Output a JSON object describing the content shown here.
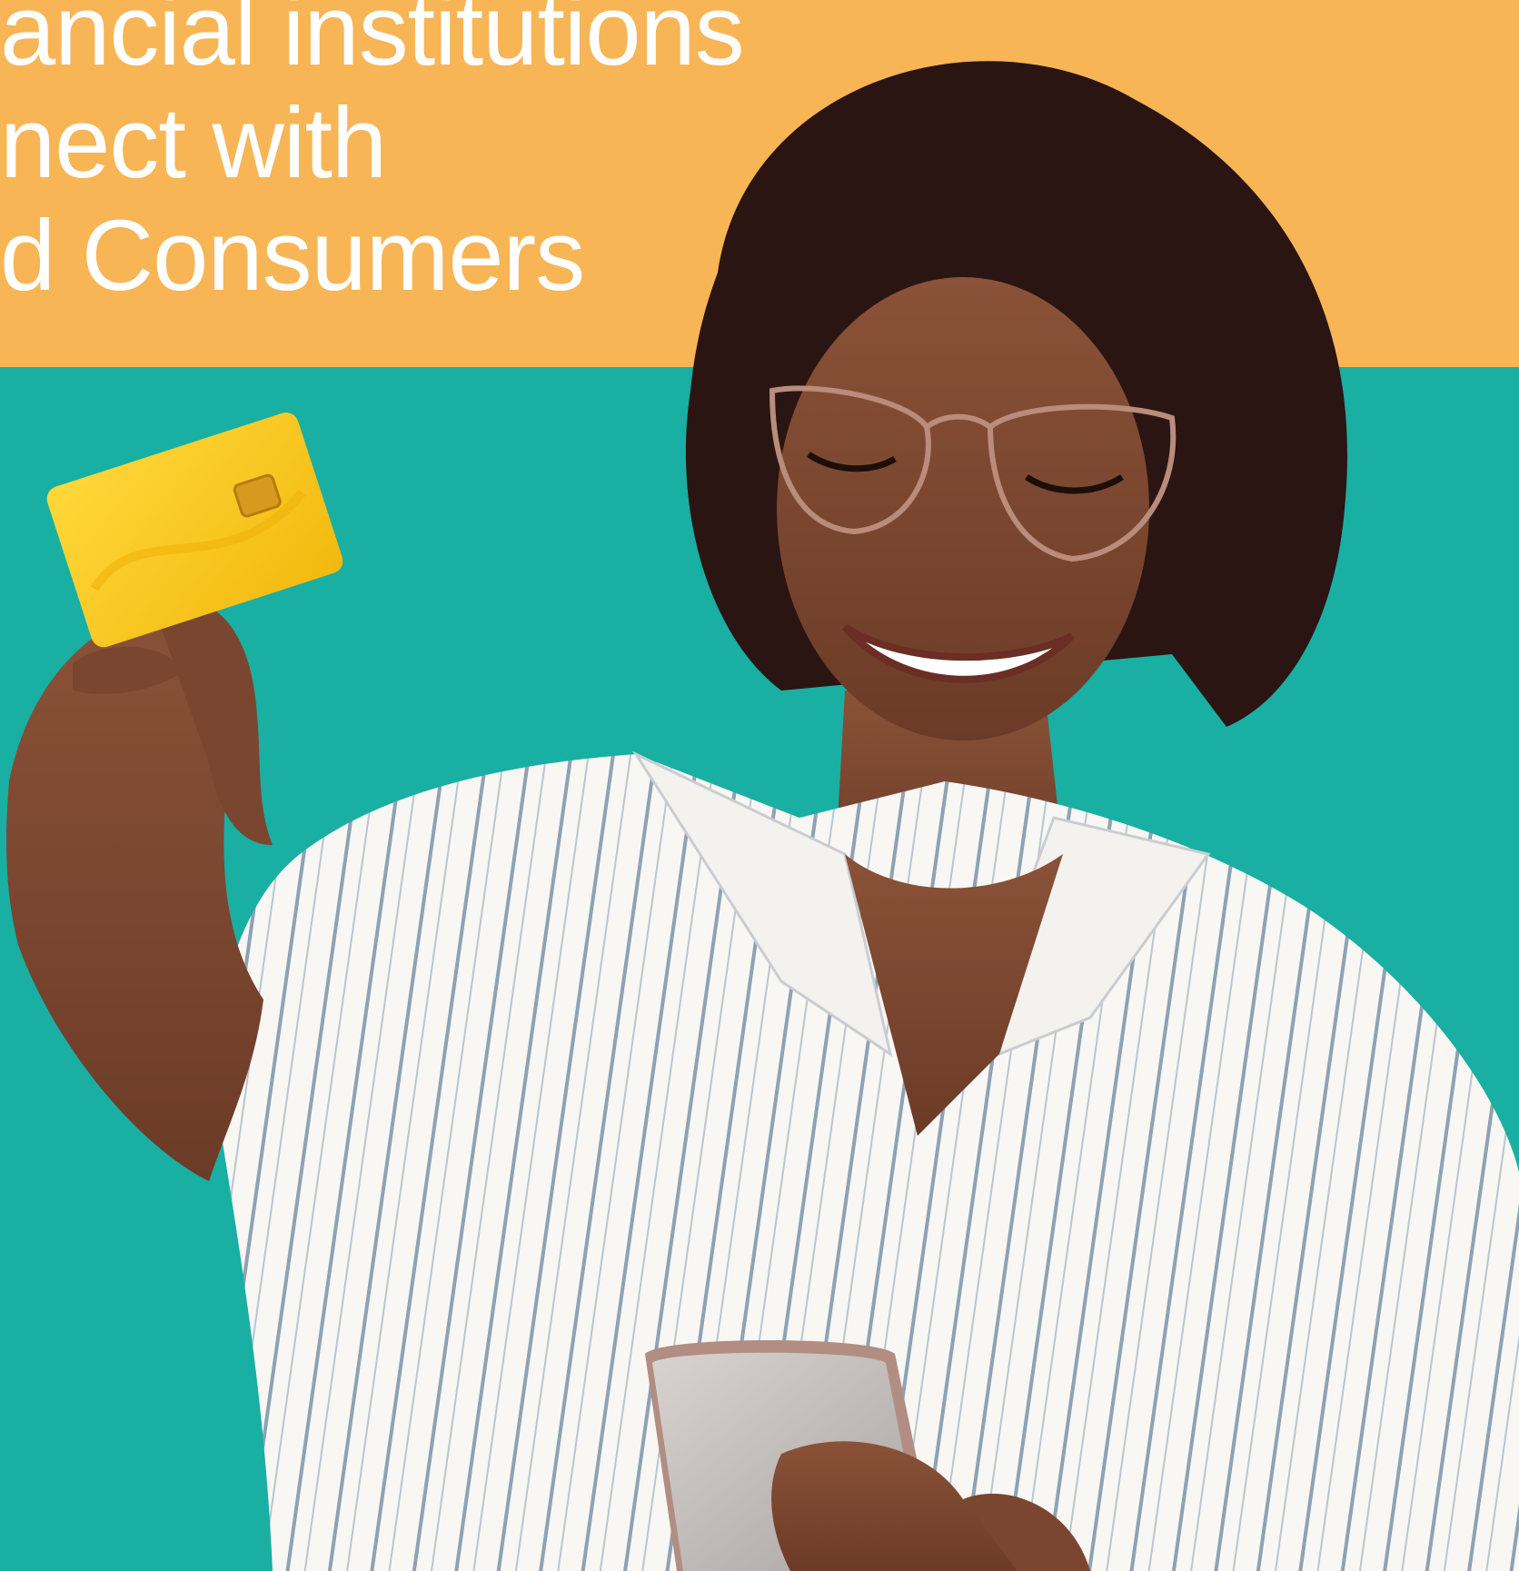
{
  "colors": {
    "top_band": "#F7B556",
    "bottom_band": "#19AFA3",
    "headline_text": "#FFFFFF",
    "card": "#F6C51B",
    "shirt": "#F8F7F3",
    "shirt_stripe": "#8EA2B4",
    "skin": "#7A4630",
    "hair": "#2A1512",
    "phone": "#C9C3C0"
  },
  "headline": {
    "line1": "ancial institutions",
    "line2": "nect with",
    "line3": "d Consumers"
  }
}
